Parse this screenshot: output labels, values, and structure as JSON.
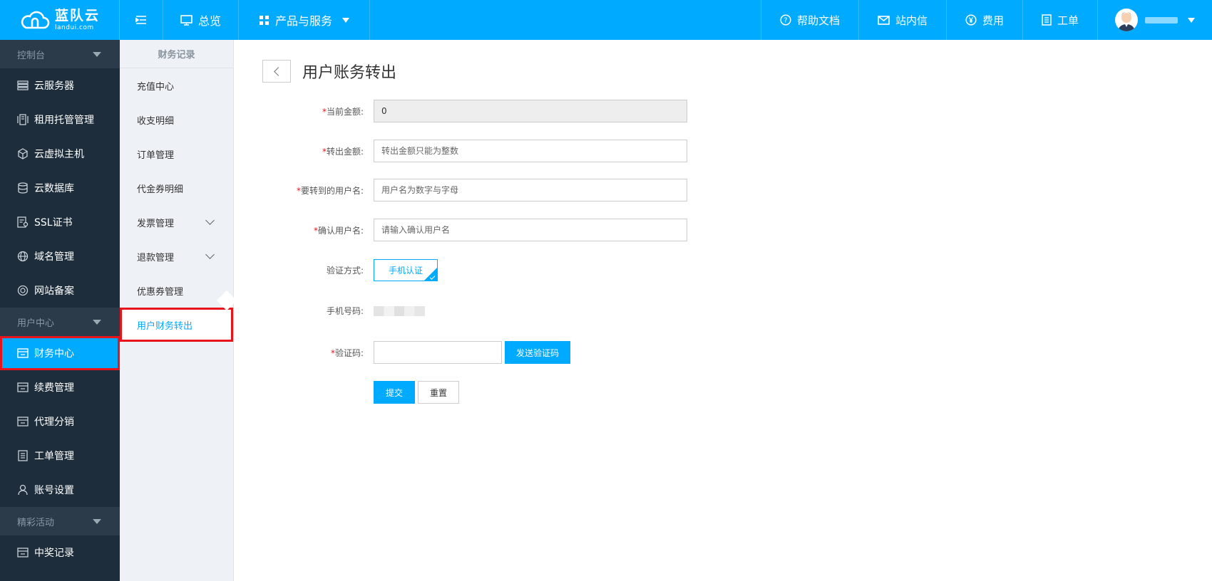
{
  "brand": {
    "name_cn": "蓝队云",
    "name_en": "landui.com"
  },
  "topbar": {
    "menu_icon": "menu-fold-icon",
    "overview": "总览",
    "products": "产品与服务",
    "help": "帮助文档",
    "inbox": "站内信",
    "fees": "费用",
    "ticket": "工单"
  },
  "sidebar": {
    "sections": [
      {
        "title": "控制台",
        "items": [
          {
            "label": "云服务器",
            "icon": "server-icon"
          },
          {
            "label": "租用托管管理",
            "icon": "rack-icon"
          },
          {
            "label": "云虚拟主机",
            "icon": "cube-icon"
          },
          {
            "label": "云数据库",
            "icon": "database-icon"
          },
          {
            "label": "SSL证书",
            "icon": "certificate-icon"
          },
          {
            "label": "域名管理",
            "icon": "globe-icon"
          },
          {
            "label": "网站备案",
            "icon": "record-icon"
          }
        ]
      },
      {
        "title": "用户中心",
        "items": [
          {
            "label": "财务中心",
            "icon": "finance-icon",
            "active": true
          },
          {
            "label": "续费管理",
            "icon": "renew-icon"
          },
          {
            "label": "代理分销",
            "icon": "agent-icon"
          },
          {
            "label": "工单管理",
            "icon": "ticket-icon"
          },
          {
            "label": "账号设置",
            "icon": "user-icon"
          }
        ]
      },
      {
        "title": "精彩活动",
        "items": [
          {
            "label": "中奖记录",
            "icon": "prize-icon"
          }
        ]
      }
    ]
  },
  "subnav": {
    "title": "财务记录",
    "items": [
      {
        "label": "充值中心"
      },
      {
        "label": "收支明细"
      },
      {
        "label": "订单管理"
      },
      {
        "label": "代金券明细"
      },
      {
        "label": "发票管理",
        "expandable": true
      },
      {
        "label": "退款管理",
        "expandable": true
      },
      {
        "label": "优惠券管理"
      },
      {
        "label": "用户财务转出",
        "active": true
      }
    ]
  },
  "page": {
    "title": "用户账务转出",
    "form": {
      "current_amount_label": "当前金额:",
      "current_amount_value": "0",
      "transfer_amount_label": "转出金额:",
      "transfer_amount_placeholder": "转出金额只能为整数",
      "target_user_label": "要转到的用户名:",
      "target_user_placeholder": "用户名为数字与字母",
      "confirm_user_label": "确认用户名:",
      "confirm_user_placeholder": "请输入确认用户名",
      "verify_method_label": "验证方式:",
      "verify_method_option": "手机认证",
      "phone_label": "手机号码:",
      "code_label": "验证码:",
      "send_code": "发送验证码",
      "submit": "提交",
      "reset": "重置"
    }
  },
  "colors": {
    "accent": "#00aaff",
    "sidebar_bg": "#1e2d3b",
    "highlight": "#e8141c"
  }
}
